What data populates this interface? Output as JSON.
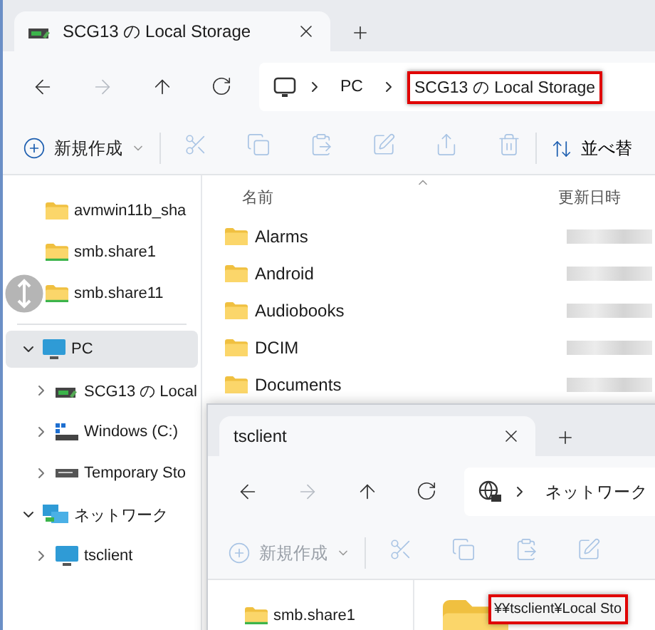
{
  "main_window": {
    "tab": {
      "title": "SCG13 の Local Storage"
    },
    "breadcrumb": [
      {
        "label": "PC",
        "highlighted": false
      },
      {
        "label": "SCG13 の Local Storage",
        "highlighted": true
      }
    ],
    "toolbar": {
      "new_button": {
        "label": "新規作成",
        "disabled": false
      },
      "sort_button": {
        "label": "並べ替"
      }
    },
    "quick_access": [
      {
        "label": "avmwin11b_sha",
        "kind": "folder"
      },
      {
        "label": "smb.share1",
        "kind": "share"
      },
      {
        "label": "smb.share11",
        "kind": "share"
      }
    ],
    "tree": [
      {
        "label": "PC",
        "kind": "pc",
        "expanded": true,
        "selected": true,
        "children": [
          {
            "label": "SCG13 の Local",
            "kind": "phone",
            "expanded": false,
            "selected": false
          },
          {
            "label": "Windows (C:)",
            "kind": "drive",
            "expanded": false,
            "selected": false
          },
          {
            "label": "Temporary Sto",
            "kind": "removable",
            "expanded": false,
            "selected": false
          }
        ]
      },
      {
        "label": "ネットワーク",
        "kind": "network",
        "expanded": true,
        "selected": false,
        "children": [
          {
            "label": "tsclient",
            "kind": "pc",
            "expanded": false,
            "selected": false
          }
        ]
      }
    ],
    "columns": [
      "名前",
      "更新日時"
    ],
    "files": [
      {
        "name": "Alarms"
      },
      {
        "name": "Android"
      },
      {
        "name": "Audiobooks"
      },
      {
        "name": "DCIM"
      },
      {
        "name": "Documents"
      }
    ]
  },
  "second_window": {
    "tab": {
      "title": "tsclient"
    },
    "breadcrumb": [
      {
        "label": "ネットワーク",
        "highlighted": false
      }
    ],
    "toolbar": {
      "new_button": {
        "label": "新規作成",
        "disabled": true
      }
    },
    "sidebar": [
      {
        "label": "smb.share1",
        "kind": "share"
      }
    ],
    "item": {
      "label": "¥¥tsclient¥Local Sto",
      "highlighted": true
    }
  }
}
